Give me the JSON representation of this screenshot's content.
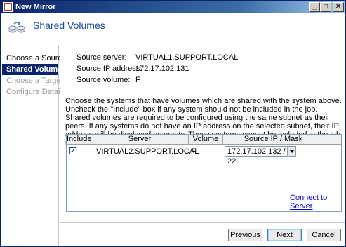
{
  "window": {
    "title": "New Mirror",
    "controls": {
      "minimize": "_",
      "maximize": "□",
      "close": "✕"
    }
  },
  "header": {
    "icon": "mirror-volumes-icon",
    "title": "Shared Volumes"
  },
  "nav": {
    "items": [
      {
        "label": "Choose a Source",
        "state": "normal"
      },
      {
        "label": "Shared Volumes",
        "state": "active"
      },
      {
        "label": "Choose a Target",
        "state": "disabled"
      },
      {
        "label": "Configure Details",
        "state": "disabled"
      }
    ]
  },
  "source": {
    "server_label": "Source server:",
    "server_value": "VIRTUAL1.SUPPORT.LOCAL",
    "ip_label": "Source IP address:",
    "ip_value": "172.17.102.131",
    "volume_label": "Source volume:",
    "volume_value": "F"
  },
  "description": "Choose the systems that have volumes which are shared with the system above. Uncheck the \"Include\" box if any system should not be included in the job. Shared volumes are required to be configured using the same subnet as their peers. If any systems do not have an IP address on the selected subnet, their IP address will be displayed as empty. These systems cannot be included in the job using this subnet.",
  "table": {
    "headers": {
      "include": "Include",
      "server": "Server",
      "volume": "Volume",
      "ip_mask": "Source IP / Mask"
    },
    "rows": [
      {
        "include": "✓",
        "server": "VIRTUAL2.SUPPORT.LOCAL",
        "volume": "F",
        "ip_mask": "172.17.102.132 / 22"
      }
    ]
  },
  "link": {
    "connect": "Connect to Server"
  },
  "buttons": {
    "previous": "Previous",
    "next": "Next",
    "cancel": "Cancel"
  },
  "colors": {
    "titlebar": "#0a246a",
    "accent": "#1f4e99",
    "link": "#0000cc",
    "selection": "#0a246a"
  }
}
